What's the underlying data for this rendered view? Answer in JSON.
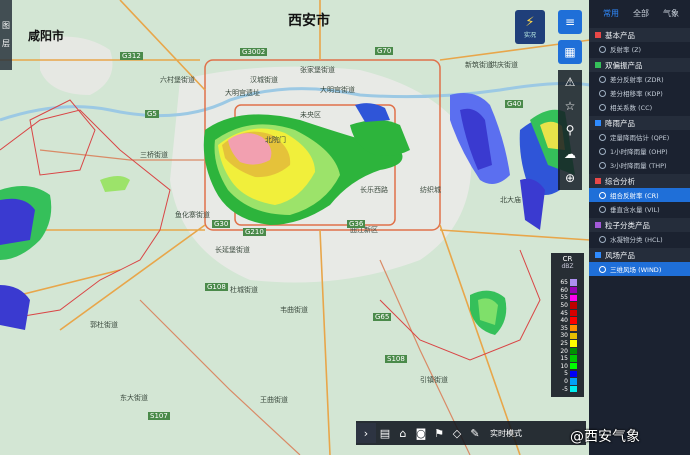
{
  "map": {
    "cities": [
      {
        "name": "西安市",
        "size": 14
      },
      {
        "name": "咸阳市",
        "size": 12
      }
    ],
    "places": [
      "北院门",
      "未央区",
      "张家堡街道",
      "大明宫街道",
      "大明宫遗址",
      "新筑街道",
      "汉城街道",
      "六村堡街道",
      "三桥街道",
      "鱼化寨街道",
      "长延堡街道",
      "曲江新区",
      "杜城街道",
      "郭杜街道",
      "韦曲街道",
      "引镇街道",
      "王曲街道",
      "东大街道",
      "北大庙",
      "纺织城",
      "洪庆街道",
      "长乐西路"
    ],
    "roads": [
      "G30",
      "G5",
      "G65",
      "G3002",
      "G210",
      "G312",
      "G108",
      "G70",
      "S107",
      "S108",
      "G40",
      "G36"
    ]
  },
  "left_panel": {
    "lines": [
      "图",
      "层"
    ]
  },
  "toolbar": {
    "live_label": "实况",
    "layers_icon": "layers-icon",
    "grid_icon": "grid-icon",
    "side_tools": [
      "radar-site-icon",
      "star-icon",
      "map-pin-icon",
      "cloud-icon",
      "target-icon"
    ]
  },
  "panel": {
    "tabs": [
      {
        "label": "常用",
        "active": true
      },
      {
        "label": "全部",
        "active": false
      },
      {
        "label": "气象",
        "active": false
      }
    ],
    "categories": [
      {
        "title": "基本产品",
        "color": "#e84848",
        "items": [
          {
            "label": "反射率 (Z)",
            "active": false
          }
        ]
      },
      {
        "title": "双偏振产品",
        "color": "#35c05a",
        "items": [
          {
            "label": "差分反射率 (ZDR)",
            "active": false
          },
          {
            "label": "差分相移率 (KDP)",
            "active": false
          },
          {
            "label": "相关系数 (CC)",
            "active": false
          }
        ]
      },
      {
        "title": "降雨产品",
        "color": "#2f8bff",
        "items": [
          {
            "label": "定量降雨估计 (QPE)",
            "active": false
          },
          {
            "label": "1小时降雨量 (OHP)",
            "active": false
          },
          {
            "label": "3小时降雨量 (THP)",
            "active": false
          }
        ]
      },
      {
        "title": "综合分析",
        "color": "#e84848",
        "items": [
          {
            "label": "组合反射率 (CR)",
            "active": true
          },
          {
            "label": "垂直含水量 (VIL)",
            "active": false
          }
        ]
      },
      {
        "title": "粒子分类产品",
        "color": "#a35ad8",
        "items": [
          {
            "label": "水凝物分类 (HCL)",
            "active": false
          }
        ]
      },
      {
        "title": "风场产品",
        "color": "#2f8bff",
        "items": [
          {
            "label": "三维风场 (WIND)",
            "active": true
          }
        ]
      }
    ]
  },
  "legend": {
    "title": "CR",
    "unit": "dBZ",
    "levels": [
      {
        "v": "65",
        "c": "#ad90f0"
      },
      {
        "v": "60",
        "c": "#9600b4"
      },
      {
        "v": "55",
        "c": "#ff00f0"
      },
      {
        "v": "50",
        "c": "#c00000"
      },
      {
        "v": "45",
        "c": "#d60000"
      },
      {
        "v": "40",
        "c": "#ff0000"
      },
      {
        "v": "35",
        "c": "#ff9000"
      },
      {
        "v": "30",
        "c": "#e7c000"
      },
      {
        "v": "25",
        "c": "#ffff00"
      },
      {
        "v": "20",
        "c": "#009000"
      },
      {
        "v": "15",
        "c": "#00c800"
      },
      {
        "v": "10",
        "c": "#00ff00"
      },
      {
        "v": "5",
        "c": "#0000f6"
      },
      {
        "v": "0",
        "c": "#01a0f6"
      },
      {
        "v": "-5",
        "c": "#00ecec"
      }
    ]
  },
  "bottom_bar": {
    "icons": [
      "chevron-right-icon",
      "chart-icon",
      "home-icon",
      "camera-icon",
      "flag-icon",
      "shape-icon",
      "pencil-icon"
    ],
    "mode_label": "实时模式"
  },
  "watermark": "@西安气象"
}
